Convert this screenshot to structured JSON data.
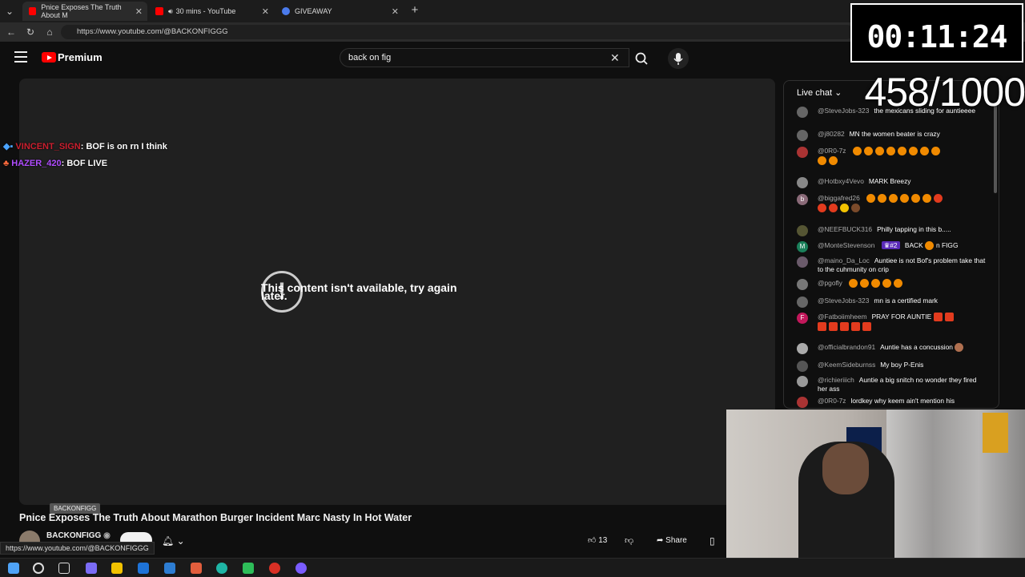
{
  "tabs": [
    {
      "label": "Pnice Exposes The Truth About M",
      "active": true
    },
    {
      "label": "30 mins - YouTube",
      "active": false
    },
    {
      "label": "GIVEAWAY",
      "active": false
    }
  ],
  "address": {
    "url": "https://www.youtube.com/@BACKONFIGGG"
  },
  "header": {
    "logo_text": "Premium",
    "search_value": "back on fig"
  },
  "player": {
    "unavailable_msg": "This content isn't available, try again later."
  },
  "overlay_chat": [
    {
      "user": "VINCENT_SIGN",
      "text": ": BOF is on rn I think"
    },
    {
      "user": "HAZER_420",
      "text": ": BOF LIVE"
    }
  ],
  "video": {
    "title": "Pnice Exposes The Truth About Marathon Burger Incident Marc Nasty In Hot Water",
    "channel": "BACKONFIGG",
    "tooltip": "BACKONFIGG",
    "likes": "13",
    "share_label": "Share",
    "status_url": "https://www.youtube.com/@BACKONFIGGG"
  },
  "live_chat": {
    "header": "Live chat",
    "messages": [
      {
        "author": "@SteveJobs-323",
        "text": "the mexicans sliding for auntieeee",
        "avatar": ""
      },
      {
        "author": "@j80282",
        "text": "MN the women beater is crazy",
        "avatar": ""
      },
      {
        "author": "@0R0-7z",
        "text": "",
        "avatar": ""
      },
      {
        "author": "@Hotbxy4Vevo",
        "text": "MARK Breezy",
        "avatar": ""
      },
      {
        "author": "@biggafred26",
        "text": "",
        "avatar": "b"
      },
      {
        "author": "@NEEFBUCK316",
        "text": "Philly tapping in this b.....",
        "avatar": ""
      },
      {
        "author": "@MonteStevenson",
        "text": "BACK",
        "text2": "n FIGG",
        "badge": "#2",
        "avatar": "M"
      },
      {
        "author": "@maino_Da_Loc",
        "text": "Auntiee is not Bof's problem take that to the cuhmunity on crip",
        "avatar": ""
      },
      {
        "author": "@pgofly",
        "text": "",
        "avatar": ""
      },
      {
        "author": "@SteveJobs-323",
        "text": "mn is a certified mark",
        "avatar": ""
      },
      {
        "author": "@Fatboiimheem",
        "text": "PRAY FOR AUNTIE",
        "avatar": "F"
      },
      {
        "author": "@officialbrandon91",
        "text": "Auntie has a concussion",
        "avatar": ""
      },
      {
        "author": "@KeemSideburnss",
        "text": "My boy P-Enis",
        "avatar": ""
      },
      {
        "author": "@richieriiich",
        "text": "Auntie a big snitch no wonder they fired her ass",
        "avatar": ""
      },
      {
        "author": "@0R0-7z",
        "text": "lordkey why keem ain't mention his",
        "avatar": ""
      }
    ]
  },
  "overlay": {
    "timer": "00:11:24",
    "counter": "458/1000"
  },
  "colors": {
    "youtube_red": "#ff0000",
    "overlay_red": "#cc1f2f",
    "overlay_purple": "#b04dff"
  }
}
